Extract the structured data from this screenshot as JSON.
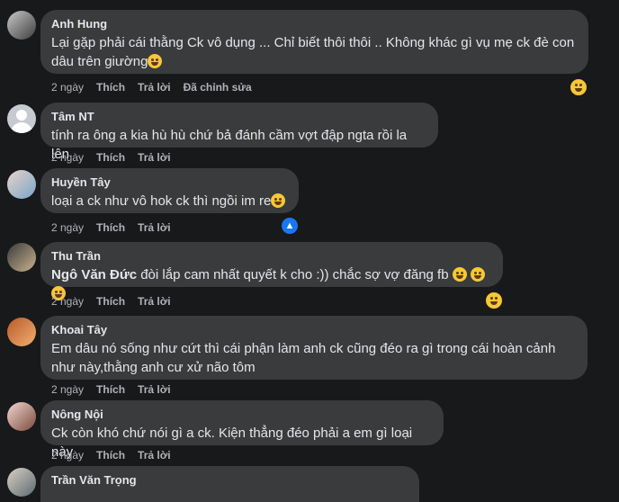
{
  "comments": [
    {
      "author": "Anh Hung",
      "text": "Lại gặp phải cái thằng Ck vô dụng ... Chỉ biết thôi thôi .. Không khác gì vụ mẹ ck đè con dâu trên giường",
      "time": "2 ngày",
      "like": "Thích",
      "reply": "Trả lời",
      "edited": "Đã chỉnh sửa"
    },
    {
      "author": "Tâm NT",
      "text": "tính ra ông a kia hù hù chứ bả đánh cầm vợt đập ngta rồi la lên",
      "time": "2 ngày",
      "like": "Thích",
      "reply": "Trả lời"
    },
    {
      "author": "Huyền Tây",
      "text": "loại a ck như vô hok ck thì ngồi im re",
      "time": "2 ngày",
      "like": "Thích",
      "reply": "Trả lời"
    },
    {
      "author": "Thu Trần",
      "mention": "Ngô Văn Đức",
      "text": " đòi lắp cam nhất quyết k cho :)) chắc sợ vợ đăng fb ",
      "time": "2 ngày",
      "like": "Thích",
      "reply": "Trả lời"
    },
    {
      "author": "Khoai Tây",
      "text_line1": "Em dâu nó sống như cứt thì cái phận làm anh ck cũng đéo ra gì trong cái hoàn cảnh",
      "text_line2": "như này,thằng anh cư xử não tôm",
      "time": "2 ngày",
      "like": "Thích",
      "reply": "Trả lời"
    },
    {
      "author": "Nông Nội",
      "text": "Ck còn khó chứ nói gì a ck. Kiện thẳng đéo phải a em gì loại này",
      "time": "2 ngày",
      "like": "Thích",
      "reply": "Trả lời"
    },
    {
      "author": "Trần Văn Trọng"
    }
  ],
  "colors": {
    "background": "#18191a",
    "bubble": "#3a3b3c",
    "text": "#e4e6eb",
    "meta": "#b0b3b8"
  },
  "icons": {
    "reaction": "haha-emoji-icon",
    "like": "like-icon"
  }
}
